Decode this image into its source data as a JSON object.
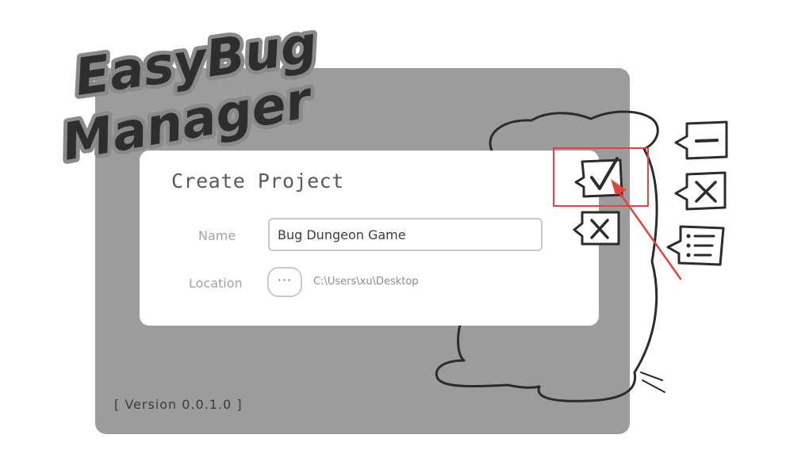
{
  "app": {
    "logo_line1": "EasyBug",
    "logo_line2": "Manager",
    "version_label": "[ Version 0.0.1.0 ]"
  },
  "dialog": {
    "title": "Create Project",
    "name_label": "Name",
    "name_value": "Bug Dungeon Game",
    "location_label": "Location",
    "browse_label": "···",
    "location_value": "C:\\Users\\xu\\Desktop"
  },
  "actions": {
    "confirm_icon": "check-speech-bubble",
    "cancel_icon": "x-speech-bubble",
    "minimize_icon": "minus-speech-bubble",
    "close_icon": "x-speech-bubble",
    "list_icon": "list-speech-bubble"
  },
  "colors": {
    "panel": "#9c9c9c",
    "highlight": "#e0443e",
    "dialog_bg": "#ffffff"
  }
}
